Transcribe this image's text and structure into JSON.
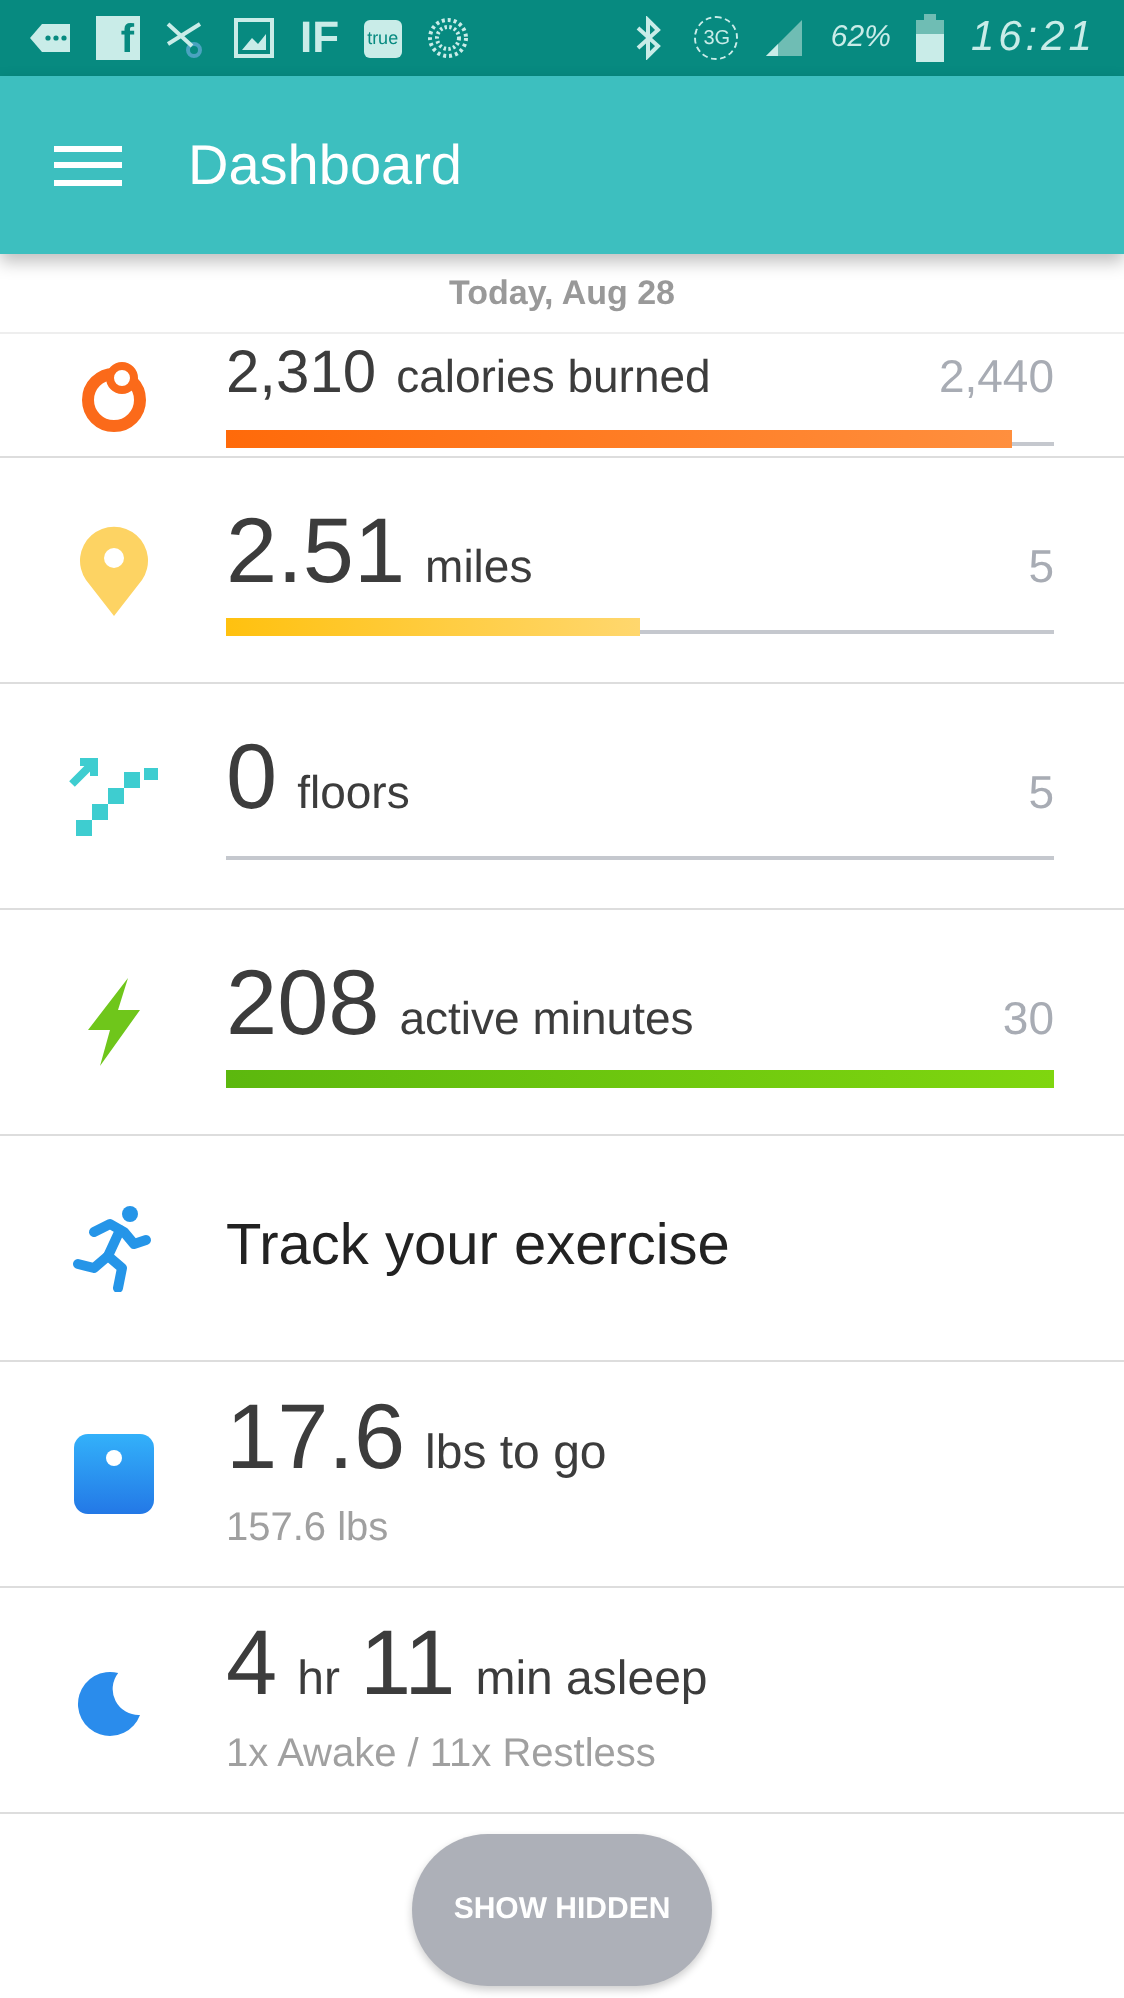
{
  "status_bar": {
    "apps": [
      "IF",
      "true"
    ],
    "facebook": "f",
    "network": "3G",
    "battery": "62%",
    "time": "16:21"
  },
  "header": {
    "title": "Dashboard"
  },
  "date": "Today, Aug 28",
  "tiles": [
    {
      "kind": "calories",
      "value": "2,310",
      "unit": "calories burned",
      "goal": "2,440",
      "level": 0.95
    },
    {
      "kind": "distance",
      "value": "2.51",
      "unit": "miles",
      "goal": "5",
      "level": 0.5
    },
    {
      "kind": "floors",
      "value": "0",
      "unit": "floors",
      "goal": "5"
    },
    {
      "kind": "active",
      "value": "208",
      "unit": "active minutes",
      "goal": "30",
      "level": 1
    },
    {
      "kind": "exercise",
      "label": "Track your exercise"
    },
    {
      "kind": "weight",
      "parts": [
        {
          "text": "17.6",
          "large": true
        },
        {
          "text": "lbs to go",
          "large": false
        }
      ],
      "detail": "157.6 lbs"
    },
    {
      "kind": "sleep",
      "parts": [
        {
          "text": "4",
          "large": true
        },
        {
          "text": "hr",
          "large": false
        },
        {
          "text": "11",
          "large": true
        },
        {
          "text": "min asleep",
          "large": false
        }
      ],
      "detail": "1x Awake / 11x Restless"
    }
  ],
  "show_hidden": "SHOW HIDDEN"
}
